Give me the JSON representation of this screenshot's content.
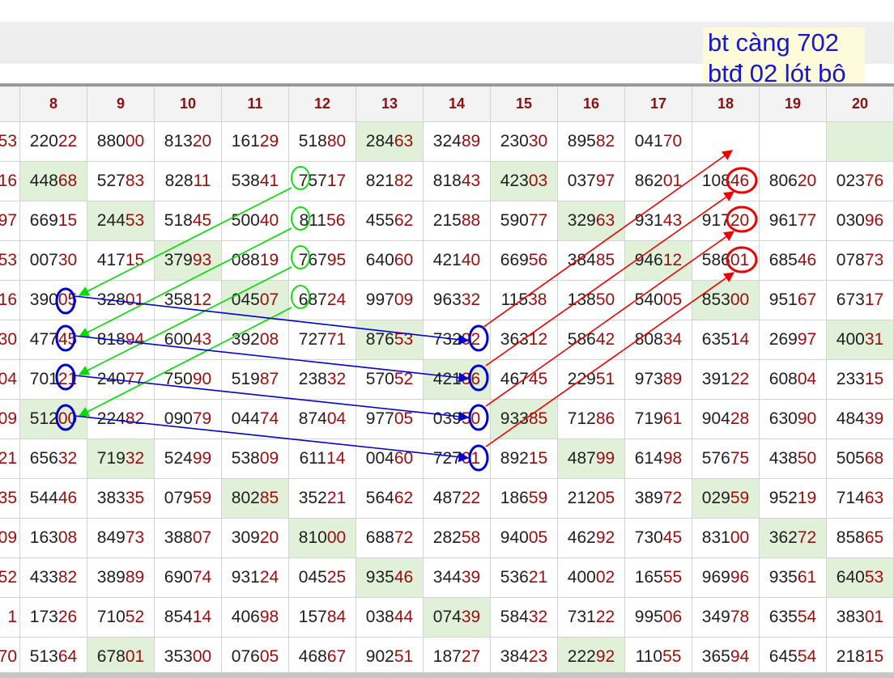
{
  "note": {
    "line1": "bt càng 702",
    "line2": "btđ 02 lót bộ"
  },
  "colors": {
    "green": "#00dd00",
    "blue": "#0000cc",
    "red": "#ee0000",
    "head": "#9b0d0d",
    "highlight": "#e1f0d8"
  },
  "table": {
    "columns": [
      "8",
      "9",
      "10",
      "11",
      "12",
      "13",
      "14",
      "15",
      "16",
      "17",
      "18",
      "19",
      "20"
    ],
    "partial_column": [
      "53",
      "16",
      "97",
      "53",
      "16",
      "30",
      "04",
      "09",
      "21",
      "35",
      "09",
      "52",
      "1",
      "70"
    ],
    "rows": [
      [
        "22022",
        "88000",
        "81320",
        "16129",
        "51880",
        "28463",
        "32489",
        "23030",
        "89582",
        "04170",
        "",
        "",
        ""
      ],
      [
        "44868",
        "52783",
        "82811",
        "53841",
        "75717",
        "82182",
        "81843",
        "42303",
        "03797",
        "86201",
        "10846",
        "80620",
        "02376"
      ],
      [
        "66915",
        "24453",
        "51845",
        "50040",
        "81156",
        "45562",
        "21588",
        "59077",
        "32963",
        "93143",
        "91720",
        "96177",
        "03096"
      ],
      [
        "00730",
        "41715",
        "37993",
        "08819",
        "76795",
        "64060",
        "42140",
        "66956",
        "38485",
        "94612",
        "58601",
        "68546",
        "07873"
      ],
      [
        "39005",
        "32801",
        "35812",
        "04507",
        "68724",
        "99709",
        "96332",
        "11538",
        "13850",
        "54005",
        "85300",
        "95167",
        "67317"
      ],
      [
        "47745",
        "81894",
        "60043",
        "39208",
        "72771",
        "87653",
        "73292",
        "36312",
        "58642",
        "80834",
        "63514",
        "26997",
        "40031"
      ],
      [
        "70121",
        "24077",
        "75090",
        "51987",
        "23832",
        "57052",
        "42136",
        "46745",
        "22951",
        "97389",
        "39122",
        "60804",
        "23315"
      ],
      [
        "51200",
        "22482",
        "09079",
        "04474",
        "87404",
        "97705",
        "03950",
        "93385",
        "71286",
        "71961",
        "90428",
        "63090",
        "48439"
      ],
      [
        "65632",
        "71932",
        "52499",
        "53809",
        "61114",
        "00460",
        "72701",
        "89215",
        "48799",
        "61498",
        "57675",
        "43850",
        "50568"
      ],
      [
        "54446",
        "38335",
        "07959",
        "80285",
        "35221",
        "56462",
        "48722",
        "18659",
        "21205",
        "38972",
        "02959",
        "95219",
        "71463"
      ],
      [
        "16308",
        "84973",
        "38807",
        "30920",
        "81000",
        "68872",
        "28258",
        "94005",
        "46292",
        "73045",
        "83100",
        "36272",
        "85865"
      ],
      [
        "43382",
        "38989",
        "69074",
        "93124",
        "04525",
        "93546",
        "34439",
        "53621",
        "40002",
        "16555",
        "96996",
        "93561",
        "64053"
      ],
      [
        "17326",
        "71052",
        "85414",
        "40698",
        "15784",
        "03844",
        "07439",
        "58432",
        "73122",
        "99506",
        "34978",
        "63554",
        "38301"
      ],
      [
        "51364",
        "67801",
        "35300",
        "07605",
        "46867",
        "90251",
        "18727",
        "38423",
        "22292",
        "11055",
        "36594",
        "64554",
        "21815"
      ]
    ],
    "highlights": [
      [
        0,
        5
      ],
      [
        0,
        12
      ],
      [
        1,
        0
      ],
      [
        1,
        7
      ],
      [
        2,
        1
      ],
      [
        2,
        8
      ],
      [
        3,
        2
      ],
      [
        3,
        9
      ],
      [
        4,
        3
      ],
      [
        4,
        10
      ],
      [
        5,
        5
      ],
      [
        5,
        12
      ],
      [
        6,
        6
      ],
      [
        7,
        0
      ],
      [
        7,
        7
      ],
      [
        8,
        1
      ],
      [
        8,
        8
      ],
      [
        9,
        3
      ],
      [
        9,
        10
      ],
      [
        10,
        4
      ],
      [
        10,
        11
      ],
      [
        11,
        5
      ],
      [
        11,
        12
      ],
      [
        12,
        6
      ],
      [
        13,
        1
      ],
      [
        13,
        8
      ]
    ]
  }
}
